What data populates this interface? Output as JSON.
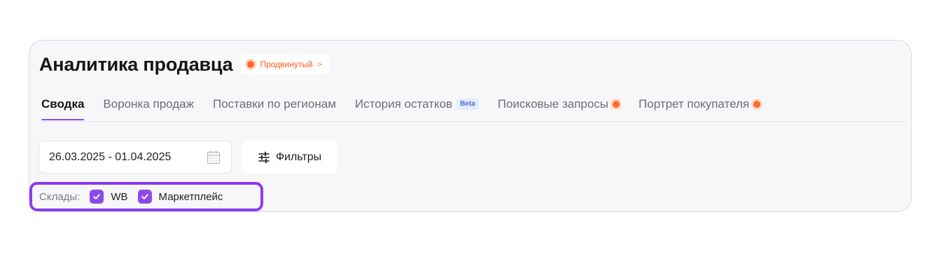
{
  "header": {
    "title": "Аналитика продавца",
    "plan_badge": {
      "label": "Продвинутый",
      "chevron": ">"
    }
  },
  "tabs": [
    {
      "label": "Сводка",
      "active": true
    },
    {
      "label": "Воронка продаж"
    },
    {
      "label": "Поставки по регионам"
    },
    {
      "label": "История остатков",
      "badge": "Beta"
    },
    {
      "label": "Поисковые запросы",
      "dot": true
    },
    {
      "label": "Портрет покупателя",
      "dot": true
    }
  ],
  "date_range": {
    "value": "26.03.2025 - 01.04.2025",
    "icon": "calendar-icon"
  },
  "filters": {
    "label": "Фильтры",
    "icon": "sliders-icon"
  },
  "warehouses": {
    "label": "Склады:",
    "options": [
      {
        "label": "WB",
        "checked": true
      },
      {
        "label": "Маркетплейс",
        "checked": true
      }
    ]
  },
  "colors": {
    "accent": "#8b4bea",
    "highlight_border": "#8b3bf0",
    "orange": "#ff6a2b",
    "beta_text": "#4a6bd8"
  }
}
